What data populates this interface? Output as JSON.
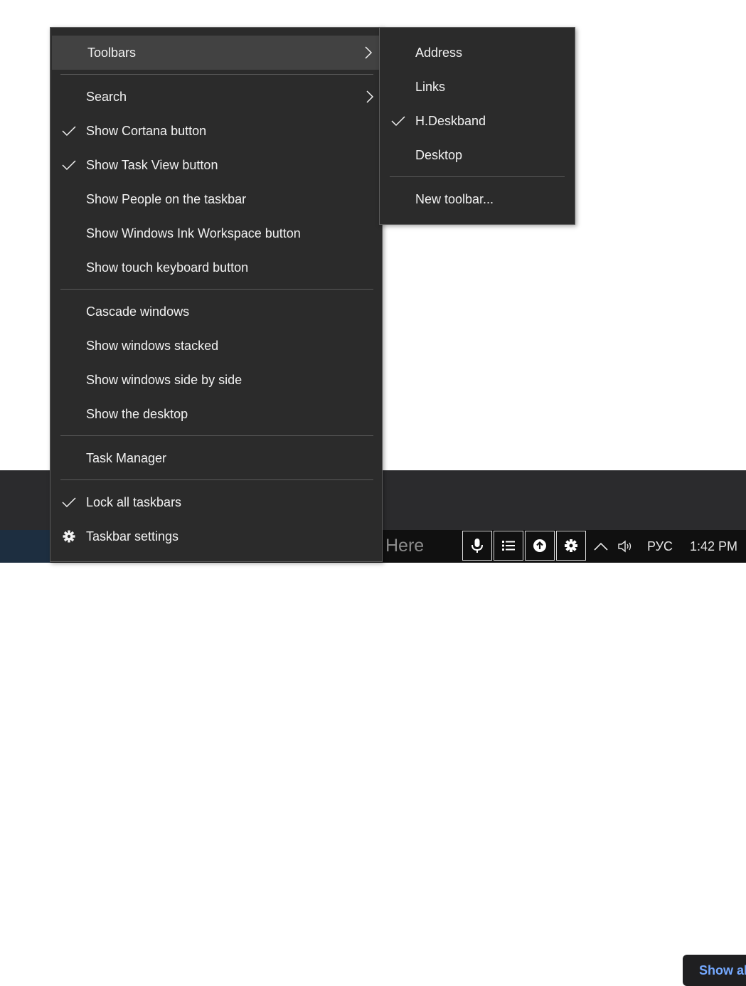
{
  "main_menu": {
    "toolbars": "Toolbars",
    "search": "Search",
    "show_cortana": "Show Cortana button",
    "show_task_view": "Show Task View button",
    "show_people": "Show People on the taskbar",
    "show_ink": "Show Windows Ink Workspace button",
    "show_touch_keyboard": "Show touch keyboard button",
    "cascade": "Cascade windows",
    "stacked": "Show windows stacked",
    "side_by_side": "Show windows side by side",
    "show_desktop": "Show the desktop",
    "task_manager": "Task Manager",
    "lock_taskbars": "Lock all taskbars",
    "taskbar_settings": "Taskbar settings"
  },
  "toolbars_submenu": {
    "address": "Address",
    "links": "Links",
    "hdeskband": "H.Deskband",
    "desktop": "Desktop",
    "new_toolbar": "New toolbar..."
  },
  "panel": {
    "show_all": "Show all"
  },
  "taskbar": {
    "search_placeholder": "Here",
    "deskband_icons": [
      "microphone-icon",
      "list-icon",
      "upload-icon",
      "gear-icon"
    ],
    "language": "РУС",
    "time": "1:42 PM"
  },
  "colors": {
    "menu_bg": "#2b2b2b",
    "menu_highlight": "#424242",
    "taskbar_bg": "#101010",
    "panel_bg": "#2b2b2d",
    "link_blue": "#75a9ff"
  }
}
